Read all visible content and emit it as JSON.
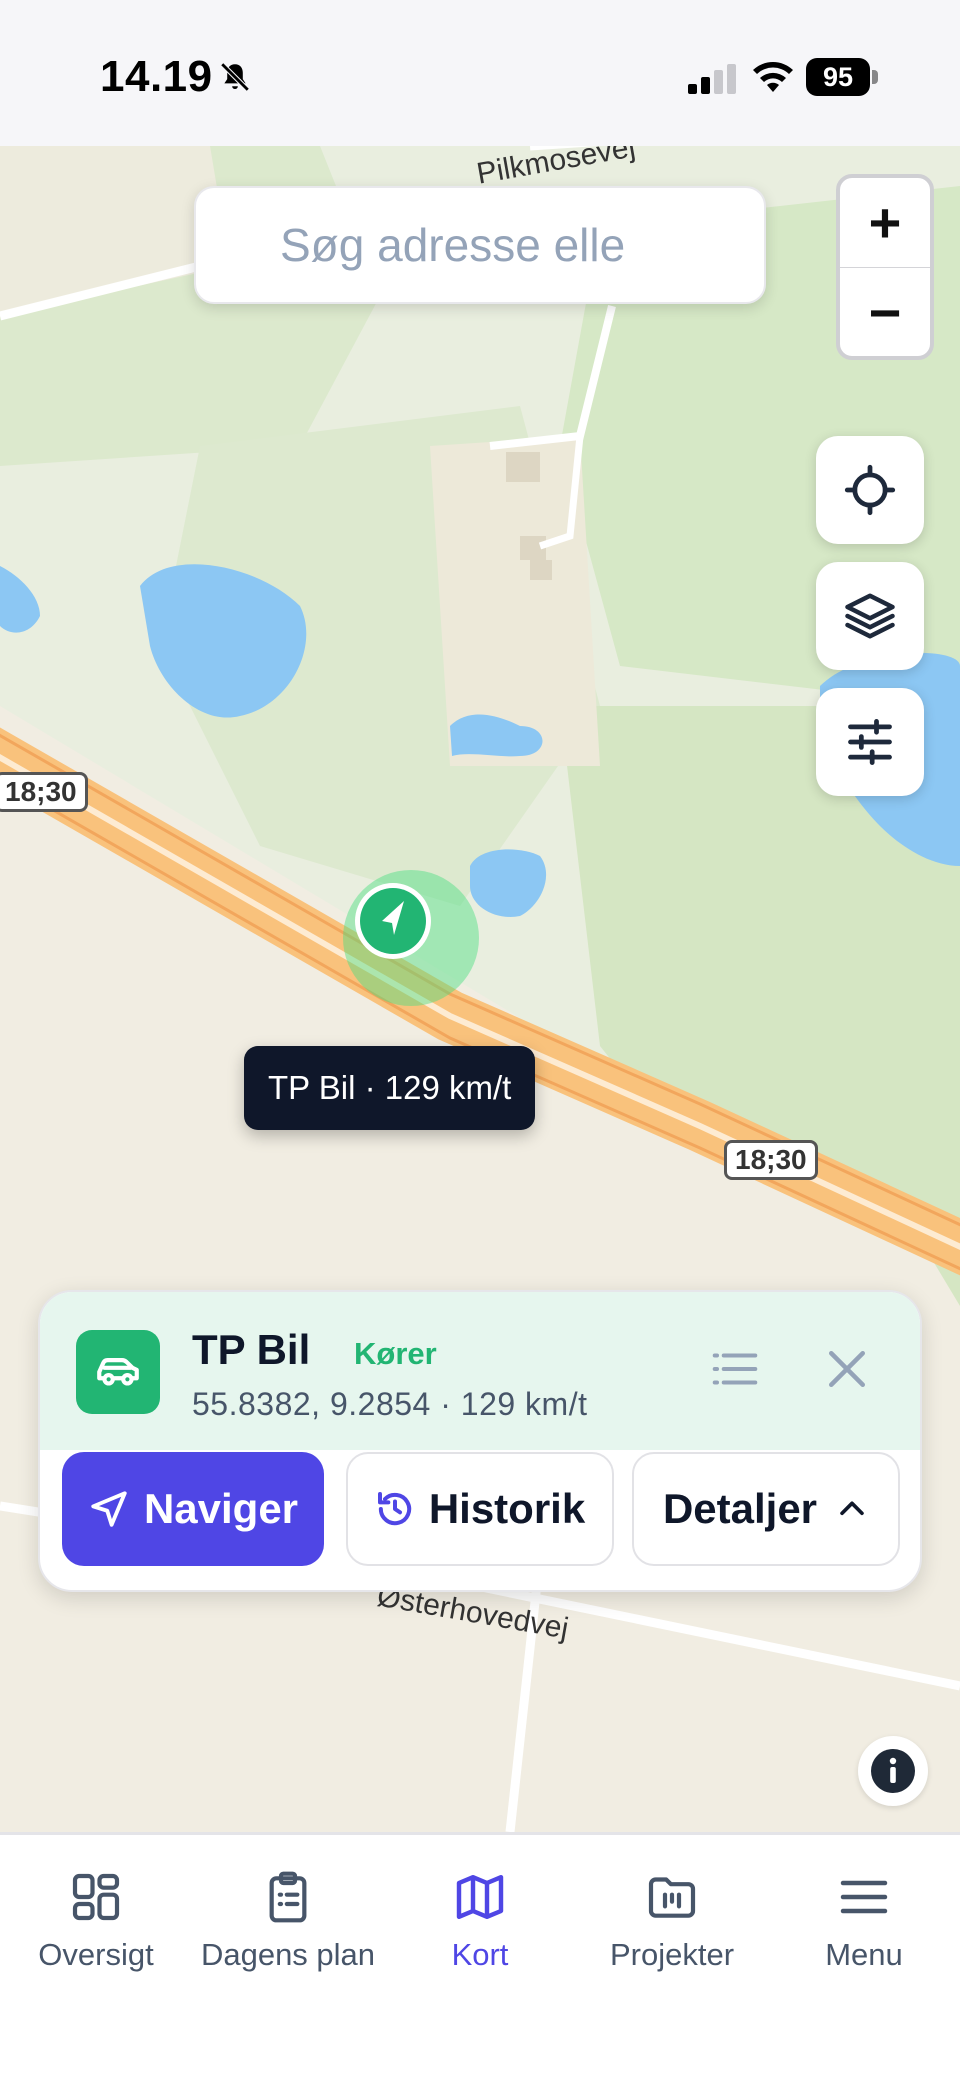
{
  "status_bar": {
    "time": "14.19",
    "battery": "95"
  },
  "map": {
    "search_placeholder": "Søg adresse elle",
    "zoom_in": "+",
    "zoom_out": "−",
    "road_labels": [
      "18;30",
      "18;30"
    ],
    "street_labels": [
      "Pilkmosevej",
      "Østerhovedvej"
    ],
    "vehicle_tooltip": "TP Bil · 129 km/t"
  },
  "vehicle_card": {
    "name": "TP Bil",
    "status": "Kører",
    "details": "55.8382, 9.2854 · 129 km/t",
    "navigate_label": "Naviger",
    "history_label": "Historik",
    "details_label": "Detaljer"
  },
  "bottom_nav": {
    "items": [
      {
        "label": "Oversigt",
        "icon": "grid-icon"
      },
      {
        "label": "Dagens plan",
        "icon": "clipboard-list-icon"
      },
      {
        "label": "Kort",
        "icon": "map-icon",
        "active": true
      },
      {
        "label": "Projekter",
        "icon": "folder-icon"
      },
      {
        "label": "Menu",
        "icon": "menu-icon"
      }
    ]
  },
  "colors": {
    "accent": "#4f46e5",
    "vehicle_green": "#22b573",
    "road_orange": "#f9c27c",
    "water": "#8cc7f3"
  }
}
